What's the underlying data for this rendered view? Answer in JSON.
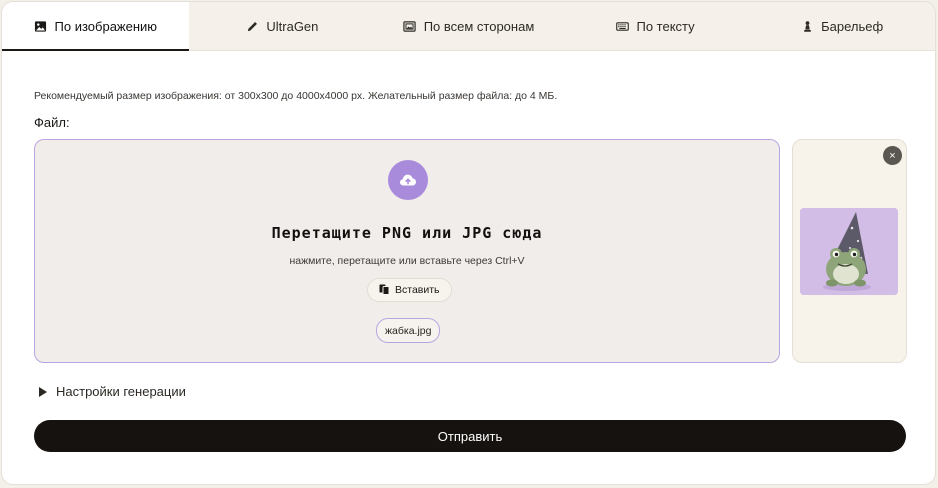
{
  "tabs": [
    {
      "label": "По изображению",
      "icon": "image-icon",
      "active": true
    },
    {
      "label": "UltraGen",
      "icon": "pencil-icon",
      "active": false
    },
    {
      "label": "По всем сторонам",
      "icon": "gallery-icon",
      "active": false
    },
    {
      "label": "По тексту",
      "icon": "keyboard-icon",
      "active": false
    },
    {
      "label": "Барельеф",
      "icon": "chess-pawn-icon",
      "active": false
    }
  ],
  "upload": {
    "hint": "Рекомендуемый размер изображения: от 300x300 до 4000x4000 px. Желательный размер файла: до 4 МБ.",
    "file_label": "Файл:",
    "drop_title": "Перетащите PNG или JPG сюда",
    "drop_subtitle": "нажмите, перетащите или вставьте через Ctrl+V",
    "paste_label": "Вставить",
    "file_name": "жабка.jpg",
    "preview_close": "×"
  },
  "settings_label": "Настройки генерации",
  "submit_label": "Отправить",
  "colors": {
    "accent": "#a98bdc",
    "dropzone_border": "#b9a6e0",
    "submit_bg": "#15120f"
  }
}
